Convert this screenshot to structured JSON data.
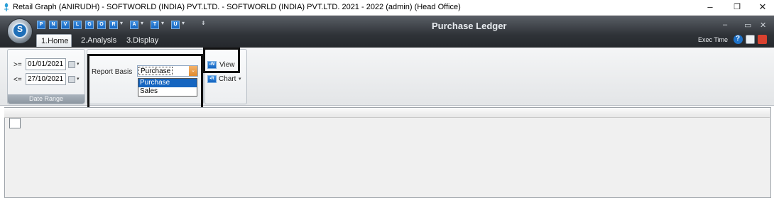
{
  "window": {
    "title": "Retail Graph (ANIRUDH) - SOFTWORLD (INDIA) PVT.LTD. - SOFTWORLD (INDIA) PVT.LTD.  2021 - 2022 (admin) (Head Office)",
    "minimize": "–",
    "restore": "❐",
    "close": "✕"
  },
  "app": {
    "title": "Purchase Ledger",
    "orb_letter": "S",
    "quick_access": [
      "P",
      "N",
      "V",
      "L",
      "G",
      "O",
      "R",
      "A",
      "T",
      "U"
    ],
    "header_controls": {
      "minimize": "–",
      "restore": "▭",
      "close": "✕"
    },
    "exec_time_label": "Exec Time"
  },
  "tabs": [
    {
      "label": "1.Home",
      "active": true
    },
    {
      "label": "2.Analysis",
      "active": false
    },
    {
      "label": "3.Display",
      "active": false
    }
  ],
  "date_range": {
    "from_label": ">=",
    "from_value": "01/01/2021",
    "to_label": "<=",
    "to_value": "27/10/2021",
    "caption": "Date Range"
  },
  "report_basis": {
    "label": "Report Basis",
    "value": "Purchase",
    "options": [
      "Purchase",
      "Sales"
    ]
  },
  "actions": {
    "view_label": "View",
    "chart_label": "Chart"
  },
  "colors": {
    "header_dark": "#2f3338",
    "accent_blue": "#1565c0",
    "combo_orange": "#e08a2e"
  }
}
